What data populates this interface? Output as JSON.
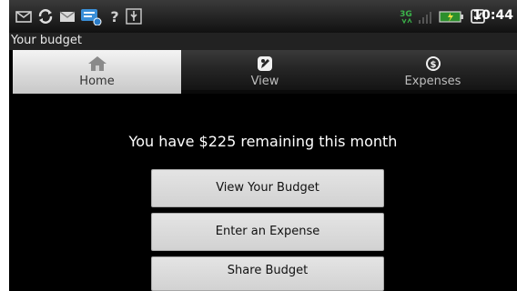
{
  "status_bar": {
    "network": "3G",
    "clock": "10:44",
    "icons": [
      "mail-icon",
      "sync-icon",
      "email-icon",
      "chat-icon",
      "help-icon",
      "usb-icon",
      "signal-icon",
      "battery-icon",
      "alarm-icon"
    ]
  },
  "app": {
    "title": "Your budget"
  },
  "tabs": [
    {
      "label": "Home",
      "icon": "home-icon",
      "active": true
    },
    {
      "label": "View",
      "icon": "view-icon",
      "active": false
    },
    {
      "label": "Expenses",
      "icon": "dollar-icon",
      "active": false
    }
  ],
  "main": {
    "remaining_text": "You have $225 remaining this month",
    "buttons": {
      "view_budget": "View Your Budget",
      "enter_expense": "Enter an Expense",
      "share_budget": "Share  Budget"
    }
  },
  "colors": {
    "background": "#000000",
    "tab_active": "#d8d8d8",
    "tab_inactive": "#262626",
    "button": "#dadada"
  }
}
